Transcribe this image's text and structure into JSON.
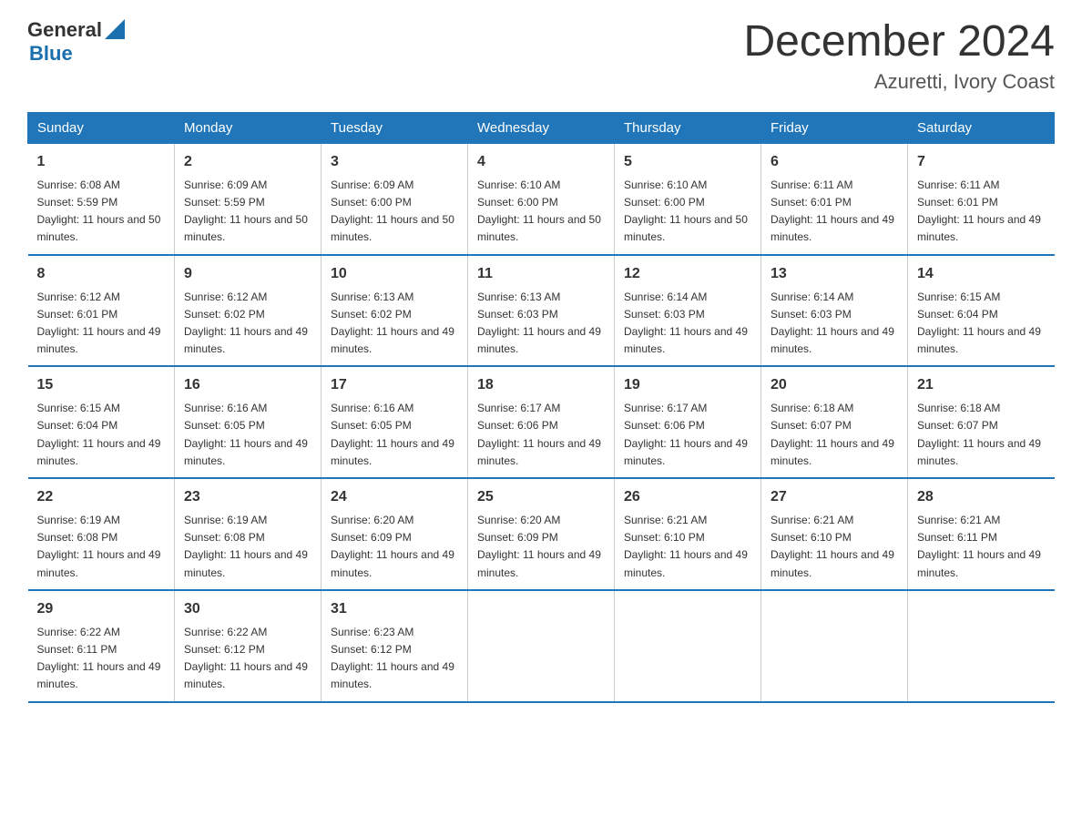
{
  "logo": {
    "general": "General",
    "blue": "Blue"
  },
  "title": "December 2024",
  "location": "Azuretti, Ivory Coast",
  "days_of_week": [
    "Sunday",
    "Monday",
    "Tuesday",
    "Wednesday",
    "Thursday",
    "Friday",
    "Saturday"
  ],
  "weeks": [
    [
      {
        "day": "1",
        "sunrise": "6:08 AM",
        "sunset": "5:59 PM",
        "daylight": "11 hours and 50 minutes."
      },
      {
        "day": "2",
        "sunrise": "6:09 AM",
        "sunset": "5:59 PM",
        "daylight": "11 hours and 50 minutes."
      },
      {
        "day": "3",
        "sunrise": "6:09 AM",
        "sunset": "6:00 PM",
        "daylight": "11 hours and 50 minutes."
      },
      {
        "day": "4",
        "sunrise": "6:10 AM",
        "sunset": "6:00 PM",
        "daylight": "11 hours and 50 minutes."
      },
      {
        "day": "5",
        "sunrise": "6:10 AM",
        "sunset": "6:00 PM",
        "daylight": "11 hours and 50 minutes."
      },
      {
        "day": "6",
        "sunrise": "6:11 AM",
        "sunset": "6:01 PM",
        "daylight": "11 hours and 49 minutes."
      },
      {
        "day": "7",
        "sunrise": "6:11 AM",
        "sunset": "6:01 PM",
        "daylight": "11 hours and 49 minutes."
      }
    ],
    [
      {
        "day": "8",
        "sunrise": "6:12 AM",
        "sunset": "6:01 PM",
        "daylight": "11 hours and 49 minutes."
      },
      {
        "day": "9",
        "sunrise": "6:12 AM",
        "sunset": "6:02 PM",
        "daylight": "11 hours and 49 minutes."
      },
      {
        "day": "10",
        "sunrise": "6:13 AM",
        "sunset": "6:02 PM",
        "daylight": "11 hours and 49 minutes."
      },
      {
        "day": "11",
        "sunrise": "6:13 AM",
        "sunset": "6:03 PM",
        "daylight": "11 hours and 49 minutes."
      },
      {
        "day": "12",
        "sunrise": "6:14 AM",
        "sunset": "6:03 PM",
        "daylight": "11 hours and 49 minutes."
      },
      {
        "day": "13",
        "sunrise": "6:14 AM",
        "sunset": "6:03 PM",
        "daylight": "11 hours and 49 minutes."
      },
      {
        "day": "14",
        "sunrise": "6:15 AM",
        "sunset": "6:04 PM",
        "daylight": "11 hours and 49 minutes."
      }
    ],
    [
      {
        "day": "15",
        "sunrise": "6:15 AM",
        "sunset": "6:04 PM",
        "daylight": "11 hours and 49 minutes."
      },
      {
        "day": "16",
        "sunrise": "6:16 AM",
        "sunset": "6:05 PM",
        "daylight": "11 hours and 49 minutes."
      },
      {
        "day": "17",
        "sunrise": "6:16 AM",
        "sunset": "6:05 PM",
        "daylight": "11 hours and 49 minutes."
      },
      {
        "day": "18",
        "sunrise": "6:17 AM",
        "sunset": "6:06 PM",
        "daylight": "11 hours and 49 minutes."
      },
      {
        "day": "19",
        "sunrise": "6:17 AM",
        "sunset": "6:06 PM",
        "daylight": "11 hours and 49 minutes."
      },
      {
        "day": "20",
        "sunrise": "6:18 AM",
        "sunset": "6:07 PM",
        "daylight": "11 hours and 49 minutes."
      },
      {
        "day": "21",
        "sunrise": "6:18 AM",
        "sunset": "6:07 PM",
        "daylight": "11 hours and 49 minutes."
      }
    ],
    [
      {
        "day": "22",
        "sunrise": "6:19 AM",
        "sunset": "6:08 PM",
        "daylight": "11 hours and 49 minutes."
      },
      {
        "day": "23",
        "sunrise": "6:19 AM",
        "sunset": "6:08 PM",
        "daylight": "11 hours and 49 minutes."
      },
      {
        "day": "24",
        "sunrise": "6:20 AM",
        "sunset": "6:09 PM",
        "daylight": "11 hours and 49 minutes."
      },
      {
        "day": "25",
        "sunrise": "6:20 AM",
        "sunset": "6:09 PM",
        "daylight": "11 hours and 49 minutes."
      },
      {
        "day": "26",
        "sunrise": "6:21 AM",
        "sunset": "6:10 PM",
        "daylight": "11 hours and 49 minutes."
      },
      {
        "day": "27",
        "sunrise": "6:21 AM",
        "sunset": "6:10 PM",
        "daylight": "11 hours and 49 minutes."
      },
      {
        "day": "28",
        "sunrise": "6:21 AM",
        "sunset": "6:11 PM",
        "daylight": "11 hours and 49 minutes."
      }
    ],
    [
      {
        "day": "29",
        "sunrise": "6:22 AM",
        "sunset": "6:11 PM",
        "daylight": "11 hours and 49 minutes."
      },
      {
        "day": "30",
        "sunrise": "6:22 AM",
        "sunset": "6:12 PM",
        "daylight": "11 hours and 49 minutes."
      },
      {
        "day": "31",
        "sunrise": "6:23 AM",
        "sunset": "6:12 PM",
        "daylight": "11 hours and 49 minutes."
      },
      {
        "day": "",
        "sunrise": "",
        "sunset": "",
        "daylight": ""
      },
      {
        "day": "",
        "sunrise": "",
        "sunset": "",
        "daylight": ""
      },
      {
        "day": "",
        "sunrise": "",
        "sunset": "",
        "daylight": ""
      },
      {
        "day": "",
        "sunrise": "",
        "sunset": "",
        "daylight": ""
      }
    ]
  ]
}
